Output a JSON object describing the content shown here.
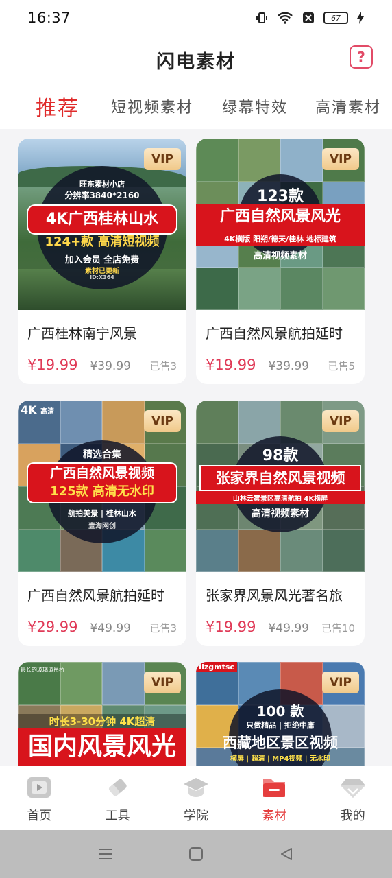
{
  "status_bar": {
    "time": "16:37",
    "battery": "67"
  },
  "header": {
    "title": "闪电素材",
    "help_glyph": "?"
  },
  "tabs": [
    {
      "label": "推荐",
      "active": true
    },
    {
      "label": "短视频素材",
      "active": false
    },
    {
      "label": "绿幕特效",
      "active": false
    },
    {
      "label": "高清素材",
      "active": false
    }
  ],
  "cards": [
    {
      "name": "广西桂林南宁风景",
      "price": "¥19.99",
      "original_price": "¥39.99",
      "sold": "已售3",
      "badge": "VIP",
      "thumb": {
        "shop": "旺东素材小店",
        "res": "分辨率3840*2160",
        "headline": "4K广西桂林山水",
        "sub": "124+款 高清短视频",
        "foot1": "加入会员 全店免费",
        "foot2": "素材已更新",
        "tag": "ID:X364"
      }
    },
    {
      "name": "广西自然风景航拍延时",
      "price": "¥19.99",
      "original_price": "¥39.99",
      "sold": "已售5",
      "badge": "VIP",
      "thumb": {
        "count": "123款",
        "headline": "广西自然风景风光",
        "sub": "4K横版 阳朔/德天/桂林 地标建筑",
        "foot": "高清视频素材"
      }
    },
    {
      "name": "广西自然风景航拍延时",
      "price": "¥29.99",
      "original_price": "¥49.99",
      "sold": "已售3",
      "badge": "VIP",
      "thumb": {
        "corner": "4K",
        "corner_sub": "高清",
        "top": "精选合集",
        "headline": "广西自然风景视频",
        "sub": "125款 高清无水印",
        "foot": "航拍美景 | 桂林山水",
        "tag": "壹淘网创"
      }
    },
    {
      "name": "张家界风景风光著名旅",
      "price": "¥19.99",
      "original_price": "¥49.99",
      "sold": "已售10",
      "badge": "VIP",
      "thumb": {
        "count": "98款",
        "headline": "张家界自然风景视频",
        "sub": "山林云雾景区高清航拍 4K横屏",
        "foot": "高清视频素材"
      }
    },
    {
      "name": "",
      "price": "",
      "original_price": "",
      "sold": "",
      "badge": "VIP",
      "thumb": {
        "top": "时长3-30分钟 4K超清",
        "headline": "国内风景风光",
        "tag": "最长的玻璃道吊桥"
      }
    },
    {
      "name": "",
      "price": "",
      "original_price": "",
      "sold": "",
      "badge": "VIP",
      "thumb": {
        "brand": "Ilzgmtsc",
        "count": "100 款",
        "top": "只做精品 | 拒绝中庸",
        "headline": "西藏地区景区视频",
        "sub": "横屏 | 超清 | MP4视频 | 无水印"
      }
    }
  ],
  "bottom_nav": [
    {
      "label": "首页",
      "icon": "play-home-icon",
      "active": false
    },
    {
      "label": "工具",
      "icon": "eraser-tool-icon",
      "active": false
    },
    {
      "label": "学院",
      "icon": "graduation-cap-icon",
      "active": false
    },
    {
      "label": "素材",
      "icon": "folder-icon",
      "active": true
    },
    {
      "label": "我的",
      "icon": "diamond-icon",
      "active": false
    }
  ],
  "colors": {
    "accent": "#e02a2a",
    "price": "#e03a57",
    "vip_bg": "#f0c98a"
  }
}
